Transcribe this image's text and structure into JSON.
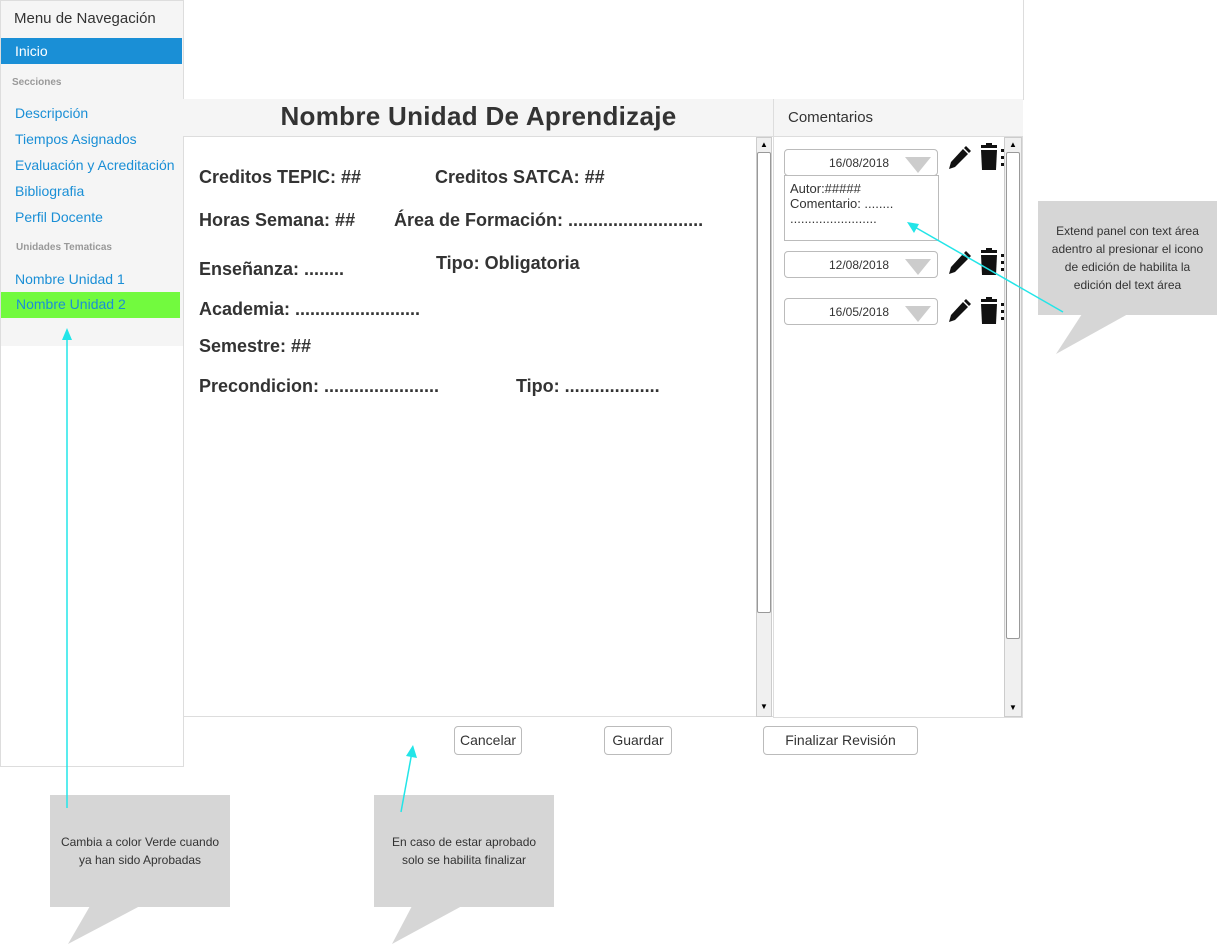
{
  "sidebar": {
    "title": "Menu de Navegación",
    "inicio": "Inicio",
    "secciones_heading": "Secciones",
    "secciones": [
      "Descripción",
      "Tiempos Asignados",
      "Evaluación y Acreditación",
      "Bibliografia",
      "Perfil Docente"
    ],
    "unidades_heading": "Unidades Tematicas",
    "unidades": [
      "Nombre Unidad 1",
      "Nombre Unidad 2"
    ]
  },
  "main": {
    "title": "Nombre Unidad De Aprendizaje",
    "fields": {
      "creditos_tepic": "Creditos TEPIC: ##",
      "creditos_satca": "Creditos SATCA: ##",
      "horas_semana": "Horas Semana: ##",
      "area_formacion": "Área de Formación: ...........................",
      "ensenanza": "Enseñanza: ........",
      "tipo_obligatoria": "Tipo: Obligatoria",
      "academia": "Academia: .........................",
      "semestre": "Semestre: ##",
      "precondicion": "Precondicion: .......................",
      "tipo": "Tipo: ..................."
    }
  },
  "comments": {
    "title": "Comentarios",
    "items": [
      {
        "date": "16/08/2018",
        "author": "Autor:#####",
        "comment": "Comentario: ........",
        "dots": "........................"
      },
      {
        "date": "12/08/2018"
      },
      {
        "date": "16/05/2018"
      }
    ]
  },
  "buttons": {
    "cancel": "Cancelar",
    "save": "Guardar",
    "finish": "Finalizar Revisión"
  },
  "callouts": {
    "green": [
      "Cambia a color Verde cuando",
      "ya han sido Aprobadas"
    ],
    "approved": [
      "En caso de estar aprobado",
      "solo se habilita finalizar"
    ],
    "extend": [
      "Extend panel con text área",
      "adentro al presionar el icono",
      "de edición de habilita la",
      "edición del text área"
    ]
  },
  "colors": {
    "active_nav": "#1a8fd6",
    "approved_unit": "#72fa3e",
    "annotation_arrow": "#22e5e8",
    "callout_bg": "#d6d6d6"
  }
}
